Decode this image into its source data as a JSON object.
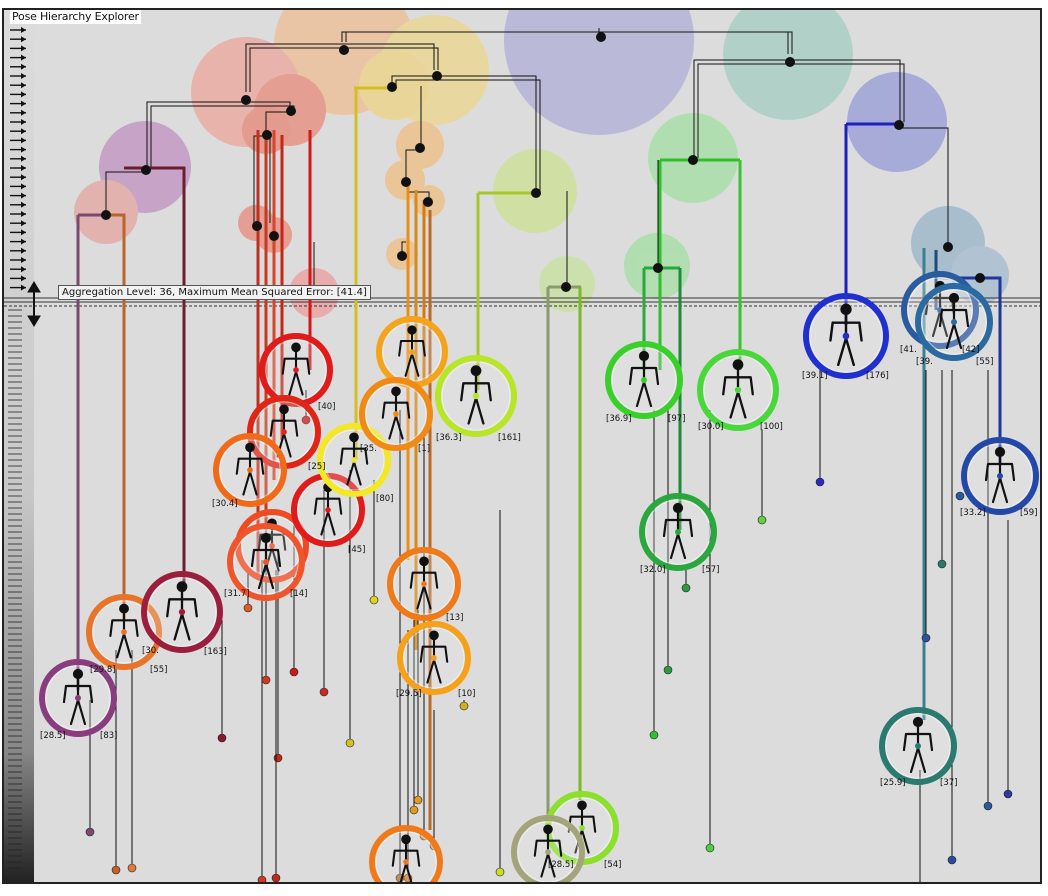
{
  "window": {
    "title": "Pose Hierarchy Explorer"
  },
  "aggregation_label": "Aggregation Level: 36, Maximum Mean Squared Error: [41.4]",
  "colors": {
    "background": "#dcdcdc",
    "frame": "#222222"
  },
  "icons": {
    "level_handle": "double-arrow-vertical-icon",
    "level_ticks": "arrow-right-icon"
  },
  "node_labels": [
    "[28.5]",
    "[83]",
    "[29.8]",
    "[55]",
    "[30.",
    "[163]",
    "[40]",
    "[31.7]",
    "[14]",
    "[30.4]",
    "[25]",
    "[35.",
    "[1]",
    "[80]",
    "[45]",
    "[29.5]",
    "[13]",
    "[10]",
    "[36.3]",
    "[161]",
    "[36.9]",
    "[97]",
    "[30.0]",
    "[100]",
    "[32.0]",
    "[57]",
    "[39.1]",
    "[176]",
    "[41.",
    "[42]",
    "[55]",
    "[39.",
    "[33.2]",
    "[59]",
    "[25.9]",
    "[37]",
    "[28.5]",
    "[54]"
  ]
}
